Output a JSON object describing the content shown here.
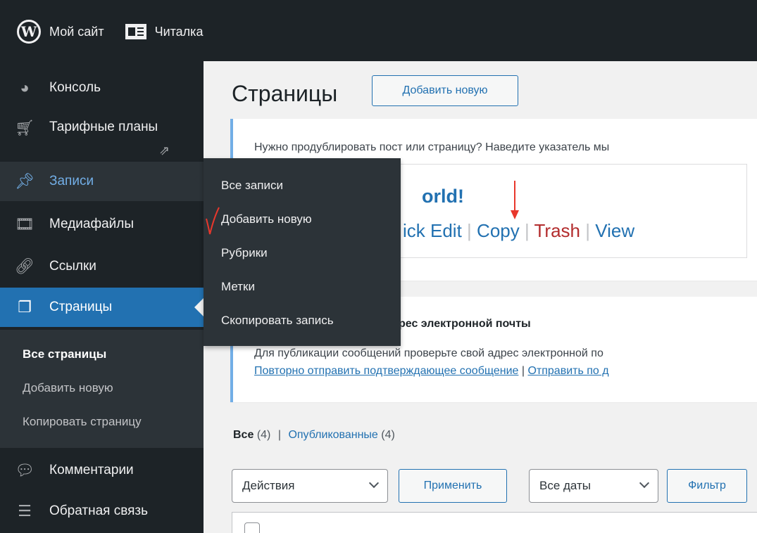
{
  "adminbar": {
    "site_label": "Мой сайт",
    "reader_label": "Читалка"
  },
  "sidebar": {
    "items": [
      {
        "label": "Консоль",
        "icon": "dashboard-icon"
      },
      {
        "label": "Тарифные планы",
        "icon": "cart-icon"
      },
      {
        "label": "Записи",
        "icon": "pin-icon"
      },
      {
        "label": "Медиафайлы",
        "icon": "media-icon"
      },
      {
        "label": "Ссылки",
        "icon": "link-icon"
      },
      {
        "label": "Страницы",
        "icon": "pages-icon"
      },
      {
        "label": "Комментарии",
        "icon": "comment-icon"
      },
      {
        "label": "Обратная связь",
        "icon": "feedback-icon"
      }
    ],
    "pages_submenu": [
      "Все страницы",
      "Добавить новую",
      "Копировать страницу"
    ]
  },
  "flyout": {
    "items": [
      "Все записи",
      "Добавить новую",
      "Рубрики",
      "Метки",
      "Скопировать запись"
    ]
  },
  "main": {
    "title": "Страницы",
    "add_new": "Добавить новую",
    "notice1": {
      "text": "Нужно продублировать пост или страницу? Наведите указатель мы",
      "preview_title": "orld!",
      "actions": {
        "quick_edit": "ick Edit",
        "copy": "Copy",
        "trash": "Trash",
        "view": "View",
        "sep": "|"
      }
    },
    "notice2": {
      "title": "рес электронной почты",
      "text": "Для публикации сообщений проверьте свой адрес электронной по",
      "link_resend": "Повторно отправить подтверждающее сообщение",
      "sep": "|",
      "link_change": "Отправить по д"
    },
    "filters": {
      "all": "Все",
      "all_count": "(4)",
      "sep": "|",
      "published": "Опубликованные",
      "published_count": "(4)"
    },
    "bulk_action": "Действия",
    "apply": "Применить",
    "date_filter": "Все даты",
    "filter_button": "Фильтр"
  },
  "colors": {
    "adminbar_bg": "#1d2327",
    "accent": "#2271b1",
    "trash": "#b32d2e",
    "annotation": "#e8372c"
  }
}
